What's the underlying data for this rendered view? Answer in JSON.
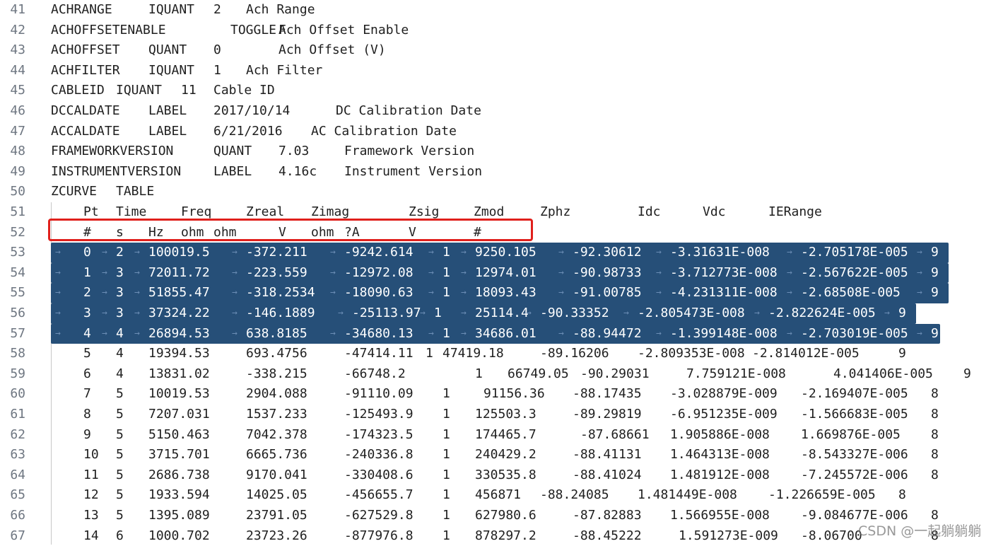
{
  "lines": [
    {
      "num": "41",
      "cells": [
        "ACHRANGE",
        "IQUANT",
        "2",
        "Ach Range"
      ]
    },
    {
      "num": "42",
      "cells": [
        "ACHOFFSETENABLE",
        "TOGGLE",
        "F",
        "Ach Offset Enable"
      ]
    },
    {
      "num": "43",
      "cells": [
        "ACHOFFSET",
        "QUANT",
        "0",
        "Ach Offset (V)"
      ]
    },
    {
      "num": "44",
      "cells": [
        "ACHFILTER",
        "IQUANT",
        "1",
        "Ach Filter"
      ]
    },
    {
      "num": "45",
      "cells": [
        "CABLEID",
        "IQUANT",
        "11",
        "Cable ID"
      ]
    },
    {
      "num": "46",
      "cells": [
        "DCCALDATE",
        "LABEL",
        "2017/10/14",
        "DC Calibration Date"
      ]
    },
    {
      "num": "47",
      "cells": [
        "ACCALDATE",
        "LABEL",
        "6/21/2016",
        "AC Calibration Date"
      ]
    },
    {
      "num": "48",
      "cells": [
        "FRAMEWORKVERSION",
        "QUANT",
        "7.03",
        "Framework Version"
      ]
    },
    {
      "num": "49",
      "cells": [
        "INSTRUMENTVERSION",
        "LABEL",
        "4.16c",
        "Instrument Version"
      ]
    },
    {
      "num": "50",
      "cells": [
        "ZCURVE",
        "TABLE"
      ]
    },
    {
      "num": "51",
      "cells": [
        "Pt",
        "Time",
        "Freq",
        "Zreal",
        "Zimag",
        "Zsig",
        "Zmod",
        "Zphz",
        "Idc",
        "Vdc",
        "IERange"
      ]
    },
    {
      "num": "52",
      "cells": [
        "#",
        "s",
        "Hz",
        "ohm",
        "ohm",
        "V",
        "ohm",
        "?A",
        "V",
        "#"
      ]
    },
    {
      "num": "53",
      "cells": [
        "0",
        "2",
        "100019.5",
        "-372.211",
        "-9242.614",
        "1",
        "9250.105",
        "-92.30612",
        "-3.31631E-008",
        "-2.705178E-005",
        "9"
      ]
    },
    {
      "num": "54",
      "cells": [
        "1",
        "3",
        "72011.72",
        "-223.559",
        "-12972.08",
        "1",
        "12974.01",
        "-90.98733",
        "-3.712773E-008",
        "-2.567622E-005",
        "9"
      ]
    },
    {
      "num": "55",
      "cells": [
        "2",
        "3",
        "51855.47",
        "-318.2534",
        "-18090.63",
        "1",
        "18093.43",
        "-91.00785",
        "-4.231311E-008",
        "-2.68508E-005",
        "9"
      ]
    },
    {
      "num": "56",
      "cells": [
        "3",
        "3",
        "37324.22",
        "-146.1889",
        "-25113.97",
        "1",
        "25114.4",
        "-90.33352",
        "-2.805473E-008",
        "-2.822624E-005",
        "9"
      ]
    },
    {
      "num": "57",
      "cells": [
        "4",
        "4",
        "26894.53",
        "638.8185",
        "-34680.13",
        "1",
        "34686.01",
        "-88.94472",
        "-1.399148E-008",
        "-2.703019E-005",
        "9"
      ]
    },
    {
      "num": "58",
      "cells": [
        "5",
        "4",
        "19394.53",
        "693.4756",
        "-47414.11",
        "1",
        "47419.18",
        "-89.16206",
        "-2.809353E-008",
        "-2.814012E-005",
        "9"
      ]
    },
    {
      "num": "59",
      "cells": [
        "6",
        "4",
        "13831.02",
        "-338.215",
        "-66748.2",
        "1",
        "66749.05",
        "-90.29031",
        "7.759121E-008",
        "4.041406E-005",
        "9"
      ]
    },
    {
      "num": "60",
      "cells": [
        "7",
        "5",
        "10019.53",
        "2904.088",
        "-91110.09",
        "1",
        "91156.36",
        "-88.17435",
        "-3.028879E-009",
        "-2.169407E-005",
        "8"
      ]
    },
    {
      "num": "61",
      "cells": [
        "8",
        "5",
        "7207.031",
        "1537.233",
        "-125493.9",
        "1",
        "125503.3",
        "-89.29819",
        "-6.951235E-009",
        "-1.566683E-005",
        "8"
      ]
    },
    {
      "num": "62",
      "cells": [
        "9",
        "5",
        "5150.463",
        "7042.378",
        "-174323.5",
        "1",
        "174465.7",
        "-87.68661",
        "1.905886E-008",
        "1.669876E-005",
        "8"
      ]
    },
    {
      "num": "63",
      "cells": [
        "10",
        "5",
        "3715.701",
        "6665.736",
        "-240336.8",
        "1",
        "240429.2",
        "-88.41131",
        "1.464313E-008",
        "-8.543327E-006",
        "8"
      ]
    },
    {
      "num": "64",
      "cells": [
        "11",
        "5",
        "2686.738",
        "9170.041",
        "-330408.6",
        "1",
        "330535.8",
        "-88.41024",
        "1.481912E-008",
        "-7.245572E-006",
        "8"
      ]
    },
    {
      "num": "65",
      "cells": [
        "12",
        "5",
        "1933.594",
        "14025.05",
        "-456655.7",
        "1",
        "456871",
        "-88.24085",
        "1.481449E-008",
        "-1.226659E-005",
        "8"
      ]
    },
    {
      "num": "66",
      "cells": [
        "13",
        "5",
        "1395.089",
        "23791.05",
        "-627529.8",
        "1",
        "627980.6",
        "-87.82883",
        "1.566955E-008",
        "-9.084677E-006",
        "8"
      ]
    },
    {
      "num": "67",
      "cells": [
        "14",
        "6",
        "1000.702",
        "23723.26",
        "-877976.8",
        "1",
        "878297.2",
        "-88.45222",
        "1.591273E-009",
        "-8.06700",
        "8"
      ]
    }
  ],
  "tab_glyph": "→",
  "watermark": "CSDN @一起躺躺躺",
  "colors": {
    "selection": "#264f78",
    "highlight_box": "#e0201c",
    "line_number": "#6e7681"
  }
}
